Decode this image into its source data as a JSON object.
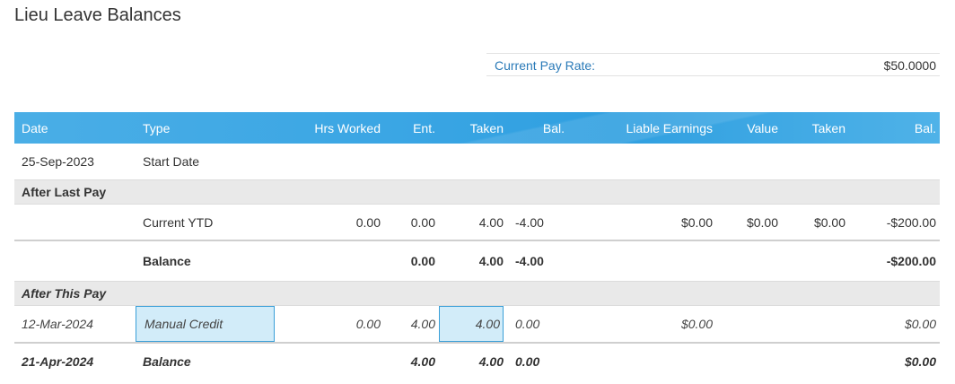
{
  "page": {
    "title": "Lieu Leave Balances"
  },
  "pay_rate": {
    "label": "Current Pay Rate:",
    "value": "$50.0000"
  },
  "columns": [
    "Date",
    "Type",
    "Hrs Worked",
    "Ent.",
    "Taken",
    "Bal.",
    "Liable Earnings",
    "Value",
    "Taken",
    "Bal."
  ],
  "rows": {
    "start": {
      "date": "25-Sep-2023",
      "type": "Start Date"
    },
    "after_last_pay": {
      "label": "After Last Pay"
    },
    "current_ytd": {
      "type": "Current YTD",
      "hrs_worked": "0.00",
      "ent": "0.00",
      "taken": "4.00",
      "bal": "-4.00",
      "liable_earnings": "$0.00",
      "value": "$0.00",
      "taken_value": "$0.00",
      "bal_value": "-$200.00"
    },
    "balance1": {
      "type": "Balance",
      "ent": "0.00",
      "taken": "4.00",
      "bal": "-4.00",
      "bal_value": "-$200.00"
    },
    "after_this_pay": {
      "label": "After This Pay"
    },
    "manual": {
      "date": "12-Mar-2024",
      "type": "Manual Credit",
      "hrs_worked": "0.00",
      "ent": "4.00",
      "taken": "4.00",
      "bal": "0.00",
      "liable_earnings": "$0.00",
      "bal_value": "$0.00"
    },
    "final": {
      "date": "21-Apr-2024",
      "type": "Balance",
      "ent": "4.00",
      "taken": "4.00",
      "bal": "0.00",
      "bal_value": "$0.00"
    }
  },
  "colors": {
    "header_blue": "#3ba6e4",
    "link_blue": "#2a7ab8",
    "highlight_fill": "#d2ecf9",
    "highlight_border": "#3a9fd8"
  }
}
